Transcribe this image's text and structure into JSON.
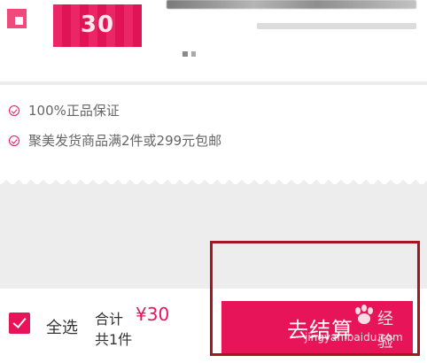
{
  "product": {
    "thumbnail_text": "30"
  },
  "guarantees": [
    {
      "text": "100%正品保证"
    },
    {
      "text": "聚美发货商品满2件或299元包邮"
    }
  ],
  "checkout": {
    "select_all_label": "全选",
    "total_label": "合计",
    "total_price": "¥30",
    "item_count": "共1件",
    "checkout_button": "去结算",
    "select_all_checked": true
  },
  "watermark": {
    "brand_text": "经验",
    "url": "jingyan.baidu.com"
  },
  "colors": {
    "accent": "#e8145a",
    "highlight_border": "#a3171f",
    "background": "#ededed"
  }
}
